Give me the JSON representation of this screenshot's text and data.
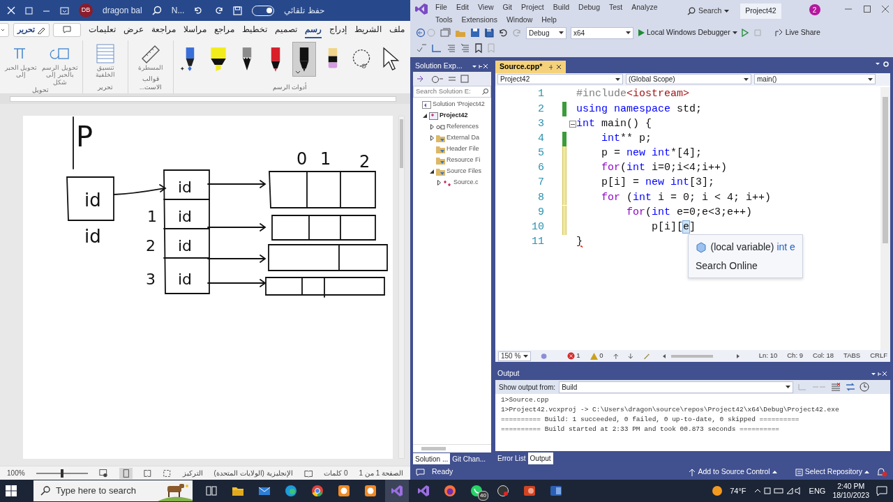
{
  "word": {
    "title_bar": {
      "autosave_label": "حفظ تلقائي",
      "autosave_on": true,
      "document": "N...",
      "user_initials": "DB",
      "user_name": "dragon bal"
    },
    "tabs": [
      {
        "label": "ملف",
        "selected": false
      },
      {
        "label": "الشريط",
        "selected": false
      },
      {
        "label": "إدراج",
        "selected": false
      },
      {
        "label": "رسم",
        "selected": true
      },
      {
        "label": "تصميم",
        "selected": false
      },
      {
        "label": "تخطيط",
        "selected": false
      },
      {
        "label": "مراجع",
        "selected": false
      },
      {
        "label": "مراسلا",
        "selected": false
      },
      {
        "label": "مراجعة",
        "selected": false
      },
      {
        "label": "عرض",
        "selected": false
      },
      {
        "label": "تعليمات",
        "selected": false
      }
    ],
    "mode_button": "تحرير",
    "tools_group": {
      "label": "أدوات الرسم",
      "tools": [
        {
          "kind": "select",
          "selected": false
        },
        {
          "kind": "lasso",
          "selected": false
        },
        {
          "kind": "eraser",
          "selected": false
        },
        {
          "kind": "pen",
          "color": "#111111",
          "selected": true
        },
        {
          "kind": "pen",
          "color": "#d91f2a",
          "selected": false
        },
        {
          "kind": "pencil",
          "color": "#8c8c8c",
          "selected": false
        },
        {
          "kind": "highlighter",
          "color": "#f3ec1c",
          "selected": false
        },
        {
          "kind": "galaxy",
          "color": "#3a6fd8",
          "selected": false
        }
      ]
    },
    "groups": [
      {
        "label": "قوالب الاست...",
        "buttons": [
          {
            "kind": "ruler",
            "label": "المسطرة"
          }
        ]
      },
      {
        "label": "تحرير",
        "buttons": [
          {
            "kind": "background",
            "label": "تنسيق الخلفية"
          }
        ]
      },
      {
        "label": "تحويل",
        "buttons": [
          {
            "kind": "shape",
            "label": "تحويل الرسم بالحبر إلى شكل"
          },
          {
            "kind": "math",
            "label": "تحويل الحبر إلى"
          }
        ]
      }
    ],
    "ink_labels": [
      "P",
      "0",
      "1",
      "2",
      "id",
      "id",
      "1",
      "id",
      "2",
      "id",
      "3",
      "id",
      "id"
    ],
    "status_bar": {
      "page": "الصفحة 1 من 1",
      "words": "0 كلمات",
      "language": "الإنجليزية (الولايات المتحدة)",
      "focus": "التركيز",
      "zoom": "100%",
      "zoom_slider": {
        "level": 0.5
      }
    }
  },
  "vs": {
    "menu": [
      "File",
      "Edit",
      "View",
      "Git",
      "Project",
      "Build",
      "Debug",
      "Test",
      "Analyze",
      "Tools",
      "Extensions",
      "Window",
      "Help"
    ],
    "search": "Search",
    "solution_name": "Project42",
    "notifications": "2",
    "toolbar": {
      "configuration": "Debug",
      "platform": "x64",
      "debugger": "Local Windows Debugger",
      "live_share": "Live Share"
    },
    "solution_explorer": {
      "title": "Solution Exp...",
      "search_placeholder": "Search Solution E:",
      "tree": [
        {
          "kind": "solution",
          "label": "Solution 'Project42",
          "children": [
            {
              "kind": "project",
              "label": "Project42",
              "expanded": true,
              "children": [
                {
                  "kind": "references",
                  "label": "References",
                  "expanded": false
                },
                {
                  "kind": "filter",
                  "label": "External Da",
                  "expanded": false
                },
                {
                  "kind": "filter",
                  "label": "Header File"
                },
                {
                  "kind": "filter",
                  "label": "Resource Fi"
                },
                {
                  "kind": "filter",
                  "label": "Source Files",
                  "expanded": true,
                  "children": [
                    {
                      "kind": "file",
                      "label": "Source.c",
                      "expanded": false
                    }
                  ]
                }
              ]
            }
          ]
        }
      ]
    },
    "editor": {
      "tab": "Source.cpp*",
      "nav": [
        "Project42",
        "(Global Scope)",
        "main()"
      ],
      "lines": [
        {
          "number": "1",
          "kind": "plain",
          "fold": false,
          "tokens": [
            {
              "kind": "pre",
              "t": "#include"
            },
            {
              "kind": "str",
              "t": "<iostream>"
            }
          ]
        },
        {
          "number": "2",
          "kind": "saved",
          "fold": false,
          "tokens": [
            {
              "kind": "kw",
              "t": "using namespace"
            },
            {
              "kind": "plain",
              "t": " std;"
            }
          ]
        },
        {
          "number": "3",
          "kind": "plain",
          "fold": true,
          "tokens": [
            {
              "kind": "kw",
              "t": "int"
            },
            {
              "kind": "plain",
              "t": " main() {"
            }
          ]
        },
        {
          "number": "4",
          "kind": "saved",
          "fold": false,
          "tokens": [
            {
              "kind": "kw",
              "t": "    int"
            },
            {
              "kind": "plain",
              "t": "** p;"
            }
          ]
        },
        {
          "number": "5",
          "kind": "unsaved",
          "fold": false,
          "tokens": [
            {
              "kind": "plain",
              "t": "    p = "
            },
            {
              "kind": "kw",
              "t": "new int"
            },
            {
              "kind": "plain",
              "t": "*[4];"
            }
          ]
        },
        {
          "number": "6",
          "kind": "unsaved",
          "fold": false,
          "tokens": [
            {
              "kind": "ctl",
              "t": "    for"
            },
            {
              "kind": "plain",
              "t": "("
            },
            {
              "kind": "kw",
              "t": "int"
            },
            {
              "kind": "plain",
              "t": " i=0;i<4;i++)"
            }
          ]
        },
        {
          "number": "7",
          "kind": "unsaved",
          "fold": false,
          "tokens": [
            {
              "kind": "plain",
              "t": "    p[i] = "
            },
            {
              "kind": "kw",
              "t": "new int"
            },
            {
              "kind": "plain",
              "t": "[3];"
            }
          ]
        },
        {
          "number": "8",
          "kind": "unsaved",
          "fold": false,
          "tokens": [
            {
              "kind": "ctl",
              "t": "    for"
            },
            {
              "kind": "plain",
              "t": " ("
            },
            {
              "kind": "kw",
              "t": "int"
            },
            {
              "kind": "plain",
              "t": " i = 0; i < 4; i++)"
            }
          ]
        },
        {
          "number": "9",
          "kind": "unsaved",
          "fold": false,
          "tokens": [
            {
              "kind": "ctl",
              "t": "        for"
            },
            {
              "kind": "plain",
              "t": "("
            },
            {
              "kind": "kw",
              "t": "int"
            },
            {
              "kind": "plain",
              "t": " e=0;e<3;e++)"
            }
          ]
        },
        {
          "number": "10",
          "kind": "unsaved",
          "fold": false,
          "tokens": [
            {
              "kind": "plain",
              "t": "            p[i]["
            },
            {
              "kind": "sel",
              "t": "e"
            },
            {
              "kind": "plain",
              "t": "]"
            }
          ]
        },
        {
          "number": "11",
          "kind": "plain",
          "fold": false,
          "tokens": [
            {
              "kind": "err",
              "t": "}"
            }
          ]
        }
      ],
      "tooltip": {
        "description": "(local variable)",
        "symbol": "int e",
        "link": "Search Online"
      },
      "status": {
        "zoom": "150 %",
        "errors": "1",
        "warnings": "0",
        "line": "Ln: 10",
        "char": "Ch: 9",
        "col": "Col: 18",
        "indent": "TABS",
        "eol": "CRLF"
      }
    },
    "output": {
      "title": "Output",
      "source_label": "Show output from:",
      "source": "Build",
      "lines": [
        "1>Source.cpp",
        "1>Project42.vcxproj -> C:\\Users\\dragon\\source\\repos\\Project42\\x64\\Debug\\Project42.exe",
        "========== Build: 1 succeeded, 0 failed, 0 up-to-date, 0 skipped ==========",
        "========== Build started at 2:33 PM and took 00.873 seconds =========="
      ]
    },
    "left_tabs": [
      {
        "label": "Solution ...",
        "selected": true
      },
      {
        "label": "Git Chan...",
        "selected": false
      }
    ],
    "bottom_tabs": [
      {
        "label": "Error List",
        "selected": false
      },
      {
        "label": "Output",
        "selected": true
      }
    ],
    "status_bar": {
      "text": "Ready",
      "source_control": "Add to Source Control",
      "repository": "Select Repository"
    }
  },
  "taskbar": {
    "search_placeholder": "Type here to search",
    "apps": [
      {
        "kind": "taskview",
        "selected": false
      },
      {
        "kind": "folder",
        "selected": false
      },
      {
        "kind": "mail",
        "selected": false
      },
      {
        "kind": "edge",
        "selected": false
      },
      {
        "kind": "chrome",
        "selected": false
      },
      {
        "kind": "app_orange",
        "selected": false
      },
      {
        "kind": "app_orange",
        "selected": false
      },
      {
        "kind": "vs",
        "selected": true
      },
      {
        "kind": "vs",
        "selected": false
      },
      {
        "kind": "firefox",
        "selected": false
      },
      {
        "kind": "whatsapp",
        "selected": false,
        "badge": "40"
      },
      {
        "kind": "recorder",
        "selected": false
      },
      {
        "kind": "powerpoint",
        "selected": false
      },
      {
        "kind": "word",
        "selected": false
      }
    ],
    "weather": "74°F",
    "language": "ENG",
    "time": "2:40 PM",
    "date": "18/10/2023"
  }
}
